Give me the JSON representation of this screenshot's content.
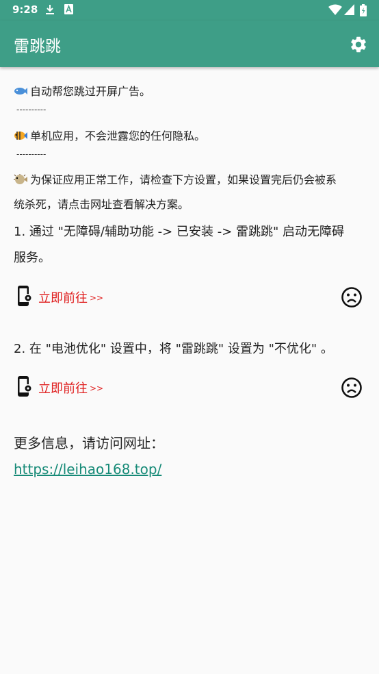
{
  "status_bar": {
    "time": "9:28",
    "icons": [
      "download-icon",
      "font-a-icon",
      "wifi-icon",
      "signal-icon",
      "battery-icon"
    ]
  },
  "app_bar": {
    "title": "雷跳跳",
    "settings_icon": "gear-icon"
  },
  "tips": [
    {
      "emoji": "fish-icon",
      "text": "自动帮您跳过开屏广告。"
    },
    {
      "emoji": "tropical-fish-icon",
      "text": "单机应用，不会泄露您的任何隐私。"
    },
    {
      "emoji": "blowfish-icon",
      "text_line1": "为保证应用正常工作，请检查下方设置，如果设置完后仍会被系",
      "text_line2": "统杀死，请点击网址查看解决方案。"
    }
  ],
  "separator": "----------",
  "steps": [
    {
      "line1": "1. 通过 \"无障碍/辅助功能 -> 已安装 -> 雷跳跳\" 启动无障碍",
      "line2": "服务。",
      "action_label": "立即前往",
      "action_arrows": ">>",
      "status_icon": "sad-face-icon"
    },
    {
      "line1": "2. 在 \"电池优化\" 设置中，将 \"雷跳跳\" 设置为 \"不优化\" 。",
      "action_label": "立即前往",
      "action_arrows": ">>",
      "status_icon": "sad-face-icon"
    }
  ],
  "more_info": {
    "label": "更多信息，请访问网址：",
    "url": "https://leihao168.top/"
  },
  "colors": {
    "primary": "#3e9e87",
    "action_red": "#e02020",
    "link": "#168a77",
    "background": "#fafafa"
  }
}
